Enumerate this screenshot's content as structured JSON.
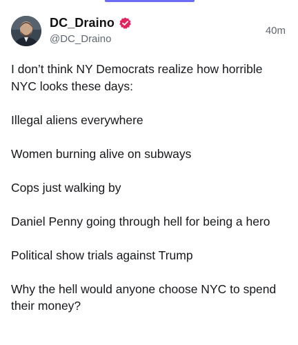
{
  "post": {
    "display_name": "DC_Draino",
    "handle": "@DC_Draino",
    "timestamp": "40m",
    "verified_badge_color": "#e0245e",
    "paragraphs": [
      "I don’t think NY Democrats realize how horrible NYC looks these days:",
      "Illegal aliens everywhere",
      "Women burning alive on subways",
      "Cops just walking by",
      "Daniel Penny going through hell for being a hero",
      "Political show trials against Trump",
      "Why the hell would anyone choose NYC to spend their money?"
    ]
  },
  "colors": {
    "top_indicator": "#6b6cf6",
    "text": "#16181c",
    "muted": "#5f6670"
  },
  "icons": {
    "verified": "verified-badge-icon",
    "avatar": "avatar"
  }
}
